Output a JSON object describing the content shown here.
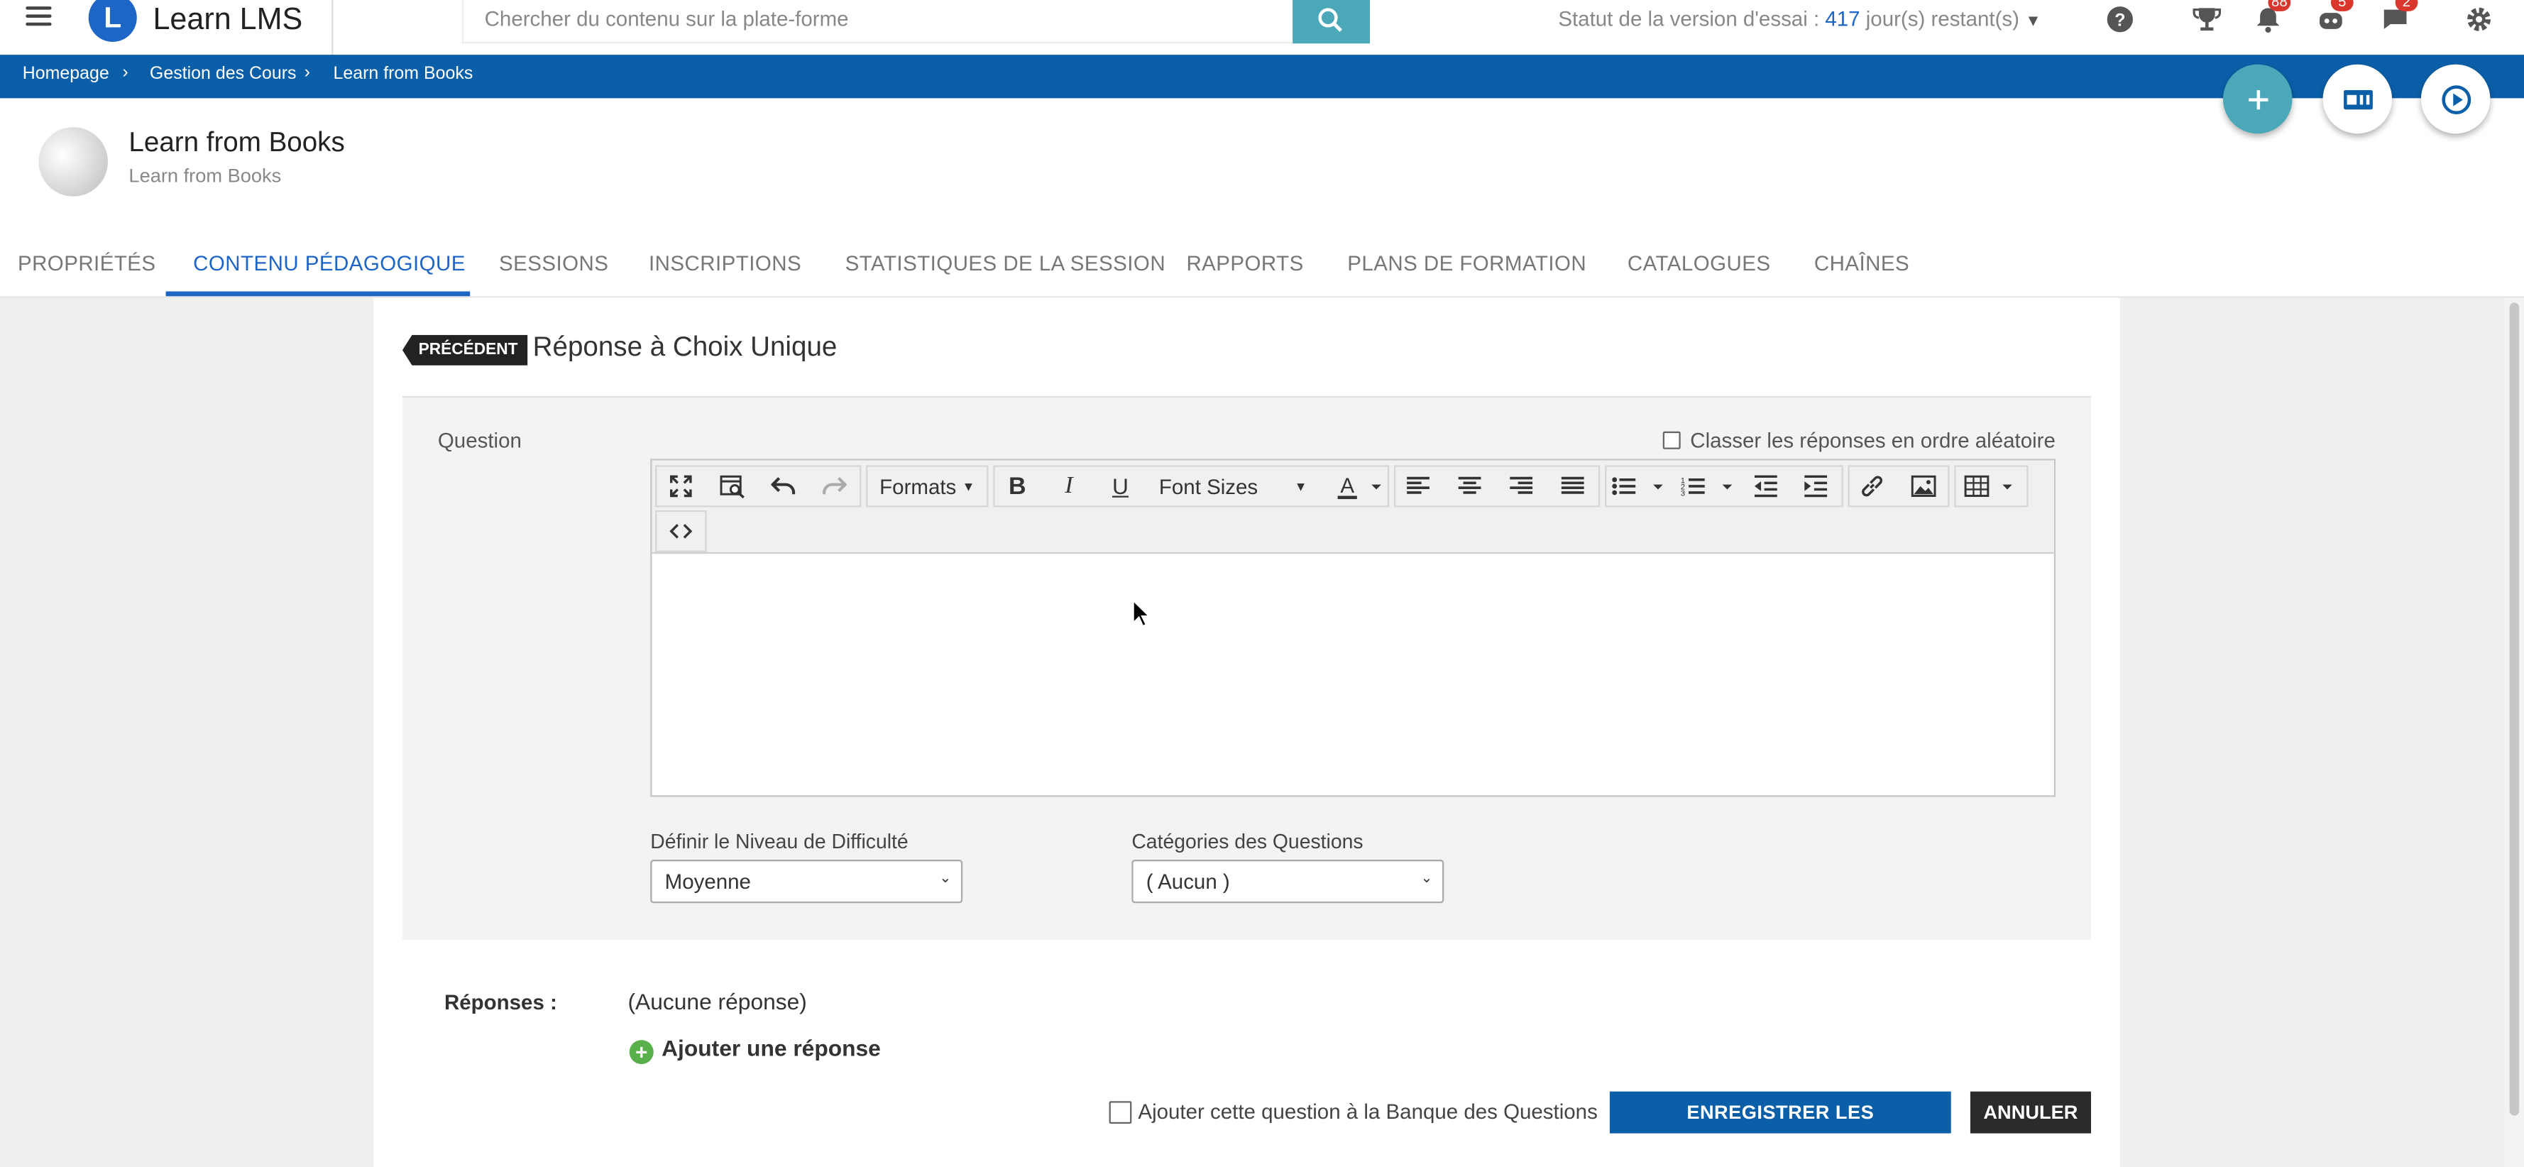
{
  "app": {
    "name": "Learn LMS",
    "logo_letter": "L"
  },
  "search": {
    "placeholder": "Chercher du contenu sur la plate-forme"
  },
  "trial": {
    "prefix": "Statut de la version d'essai : ",
    "days": "417",
    "suffix": " jour(s) restant(s)"
  },
  "notifications": {
    "bell": "88",
    "robot": "5",
    "chat": "2"
  },
  "breadcrumb": [
    "Homepage",
    "Gestion des Cours",
    "Learn from Books"
  ],
  "course": {
    "title": "Learn from Books",
    "subtitle": "Learn from Books"
  },
  "tabs": [
    "PROPRIÉTÉS",
    "CONTENU PÉDAGOGIQUE",
    "SESSIONS",
    "INSCRIPTIONS",
    "STATISTIQUES DE LA SESSION",
    "RAPPORTS",
    "PLANS DE FORMATION",
    "CATALOGUES",
    "CHAÎNES"
  ],
  "active_tab": "CONTENU PÉDAGOGIQUE",
  "form": {
    "prev_label": "PRÉCÉDENT",
    "title": "Réponse à Choix Unique",
    "question_label": "Question",
    "random_label": "Classer les réponses en ordre aléatoire",
    "random_checked": false,
    "editor": {
      "formats_label": "Formats",
      "font_sizes_label": "Font Sizes",
      "content": ""
    },
    "difficulty_label": "Définir le Niveau de Difficulté",
    "difficulty_value": "Moyenne",
    "category_label": "Catégories des Questions",
    "category_value": "( Aucun )",
    "answers_label": "Réponses :",
    "answers_empty": "(Aucune réponse)",
    "add_answer": "Ajouter une réponse",
    "bank_label": "Ajouter cette question à la Banque des Questions",
    "bank_checked": false,
    "save_label": "ENREGISTRER LES MODIFICATIONS",
    "cancel_label": "ANNULER"
  },
  "colors": {
    "primary": "#0b5fa8",
    "accent": "#1e66c5",
    "teal": "#4aa8b8",
    "badge": "#d9372e",
    "add_green": "#58b04a"
  }
}
